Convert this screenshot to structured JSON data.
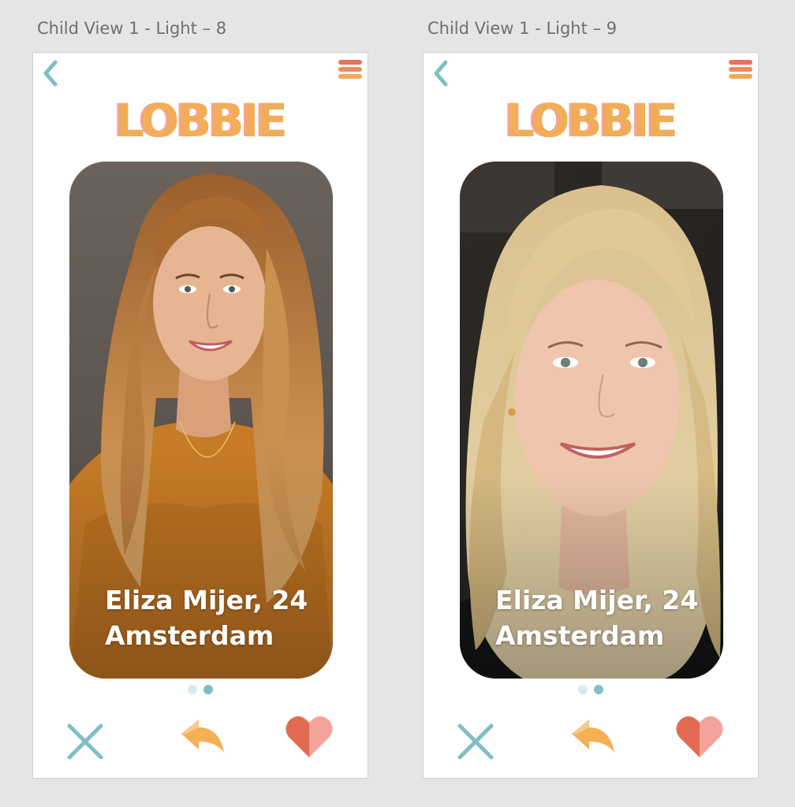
{
  "artboards": [
    {
      "label": "Child View 1 - Light – 8",
      "app": {
        "logo": "LOBBIE"
      },
      "profile": {
        "name_age": "Eliza Mijer, 24",
        "city": "Amsterdam",
        "photo_index": 2
      },
      "actions": {
        "reject": "close-icon",
        "undo": "reply-icon",
        "like": "heart-icon"
      }
    },
    {
      "label": "Child View 1 - Light – 9",
      "app": {
        "logo": "LOBBIE"
      },
      "profile": {
        "name_age": "Eliza Mijer, 24",
        "city": "Amsterdam",
        "photo_index": 2
      },
      "actions": {
        "reject": "close-icon",
        "undo": "reply-icon",
        "like": "heart-icon"
      }
    }
  ],
  "pager": {
    "total": 2,
    "active": 2
  },
  "colors": {
    "background": "#e5e5e5",
    "logo_orange": "#f2ad58",
    "logo_pink": "#f3a39a",
    "teal": "#7fbec4",
    "light_teal": "#d7ebee",
    "heart_red": "#e26a52",
    "heart_pink": "#f4a39a",
    "undo_orange": "#f5b055",
    "menu_red": "#e8725f",
    "menu_orange": "#f2a95a"
  }
}
